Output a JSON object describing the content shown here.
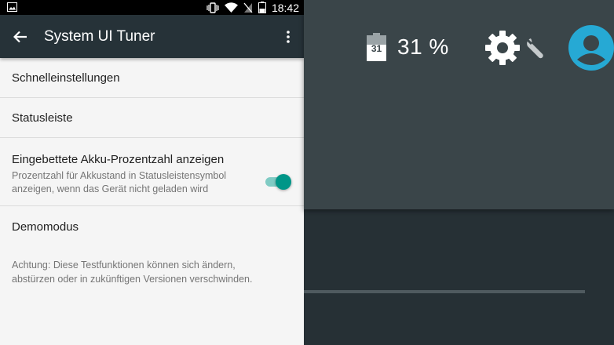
{
  "status_bar": {
    "time": "18:42",
    "icons": [
      "image-icon",
      "vibrate-icon",
      "wifi-icon",
      "no-sim-icon",
      "battery-icon"
    ]
  },
  "toolbar": {
    "title": "System UI Tuner",
    "back_icon": "arrow-back-icon",
    "menu_icon": "more-vert-icon"
  },
  "settings": {
    "items": [
      {
        "title": "Schnelleinstellungen"
      },
      {
        "title": "Statusleiste"
      },
      {
        "title": "Eingebettete Akku-Prozentzahl anzeigen",
        "subtitle": "Prozentzahl für Akkustand in Statusleistensymbol anzeigen, wenn das Gerät nicht geladen wird",
        "toggle_on": true
      },
      {
        "title": "Demomodus"
      }
    ],
    "footer": "Achtung: Diese Testfunktionen können sich ändern, abstürzen oder in zukünftigen Versionen verschwinden."
  },
  "zoom_header": {
    "battery_level_text": "31",
    "battery_percent": "31 %",
    "icons": [
      "battery-icon",
      "settings-gear-icon",
      "wrench-icon",
      "account-avatar-icon"
    ]
  },
  "colors": {
    "toolbar": "#263238",
    "accent": "#009688",
    "accent_track": "#80cbc4",
    "qs_background": "#3a4549"
  }
}
